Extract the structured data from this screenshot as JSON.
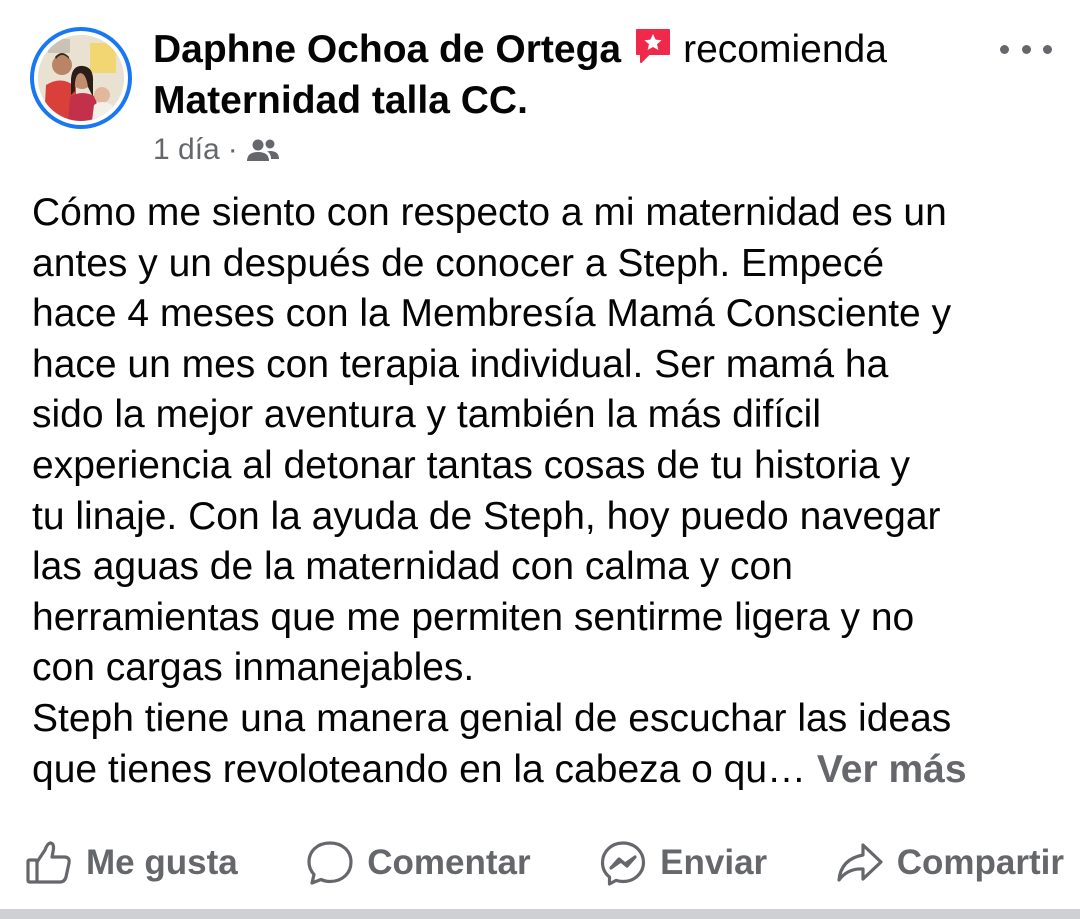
{
  "post": {
    "author": "Daphne Ochoa de Ortega",
    "recommend_verb": "recomienda",
    "page_name": "Maternidad talla CC.",
    "time": "1 día",
    "separator": "·",
    "audience_icon": "friends-icon",
    "recommend_icon": "recommendation-star-icon",
    "text_lines": [
      "Cómo me siento con respecto a mi maternidad es un",
      "antes y un después de conocer a Steph. Empecé",
      "hace 4 meses con la Membresía Mamá Consciente y",
      "hace un mes con terapia individual. Ser mamá ha",
      "sido la mejor aventura y también la más difícil",
      "experiencia al detonar tantas cosas de tu historia y",
      "tu linaje. Con la ayuda de Steph, hoy puedo navegar",
      "las aguas de la maternidad con calma y con",
      "herramientas que me permiten sentirme ligera y no",
      "con cargas inmanejables.",
      "Steph tiene una manera genial de escuchar las ideas",
      "que tienes revoloteando en la cabeza o qu…"
    ],
    "see_more": "Ver más"
  },
  "actions": {
    "like": "Me gusta",
    "comment": "Comentar",
    "send": "Enviar",
    "share": "Compartir"
  },
  "colors": {
    "brand_blue": "#1877f2",
    "secondary_text": "#65676b",
    "recommend_badge": "#f02849"
  }
}
